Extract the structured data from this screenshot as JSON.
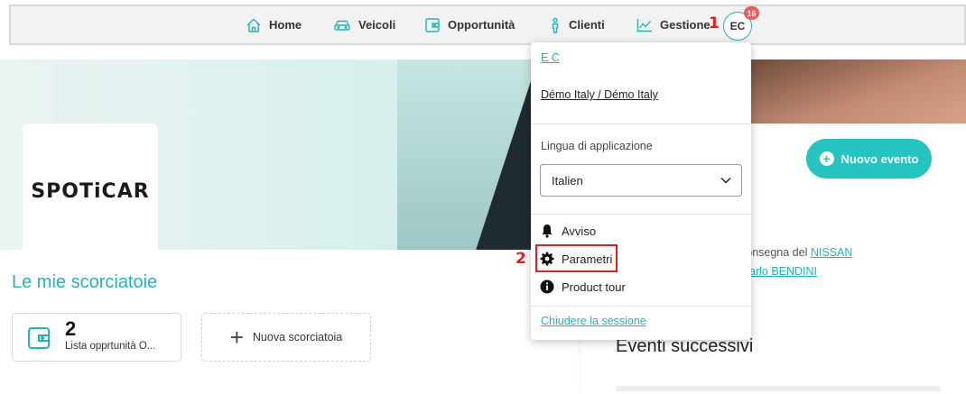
{
  "nav": {
    "items": [
      {
        "label": "Home",
        "icon": "home-icon"
      },
      {
        "label": "Veicoli",
        "icon": "car-icon"
      },
      {
        "label": "Opportunità",
        "icon": "wallet-icon"
      },
      {
        "label": "Clienti",
        "icon": "person-icon"
      },
      {
        "label": "Gestione",
        "icon": "chart-icon"
      }
    ],
    "avatar_initials": "EC",
    "notification_count": "16"
  },
  "annotations": {
    "step1": "1",
    "step2": "2"
  },
  "hero": {
    "logo_text": "SPOTiCAR"
  },
  "shortcuts": {
    "title": "Le mie scorciatoie",
    "card": {
      "count": "2",
      "label": "Lista opprtunità O..."
    },
    "new_label": "Nuova scorciatoia"
  },
  "right_panel": {
    "new_event_label": "Nuovo evento",
    "line1_text": "consegna del ",
    "line1_link": "NISSAN",
    "line2_link": "arlo BENDINI",
    "next_events_title": "Eventi successivi"
  },
  "dropdown": {
    "user_link": "E C",
    "org_link": "Démo Italy / Démo Italy",
    "language_label": "Lingua di applicazione",
    "language_value": "Italien",
    "items": [
      {
        "label": "Avviso",
        "icon": "bell-icon"
      },
      {
        "label": "Parametri",
        "icon": "gear-icon"
      },
      {
        "label": "Product tour",
        "icon": "info-icon"
      }
    ],
    "logout_label": "Chiudere la sessione"
  },
  "colors": {
    "accent": "#25b3b7",
    "button": "#25c4c0",
    "highlight": "#e01e1e",
    "badge": "#f25a5a"
  }
}
